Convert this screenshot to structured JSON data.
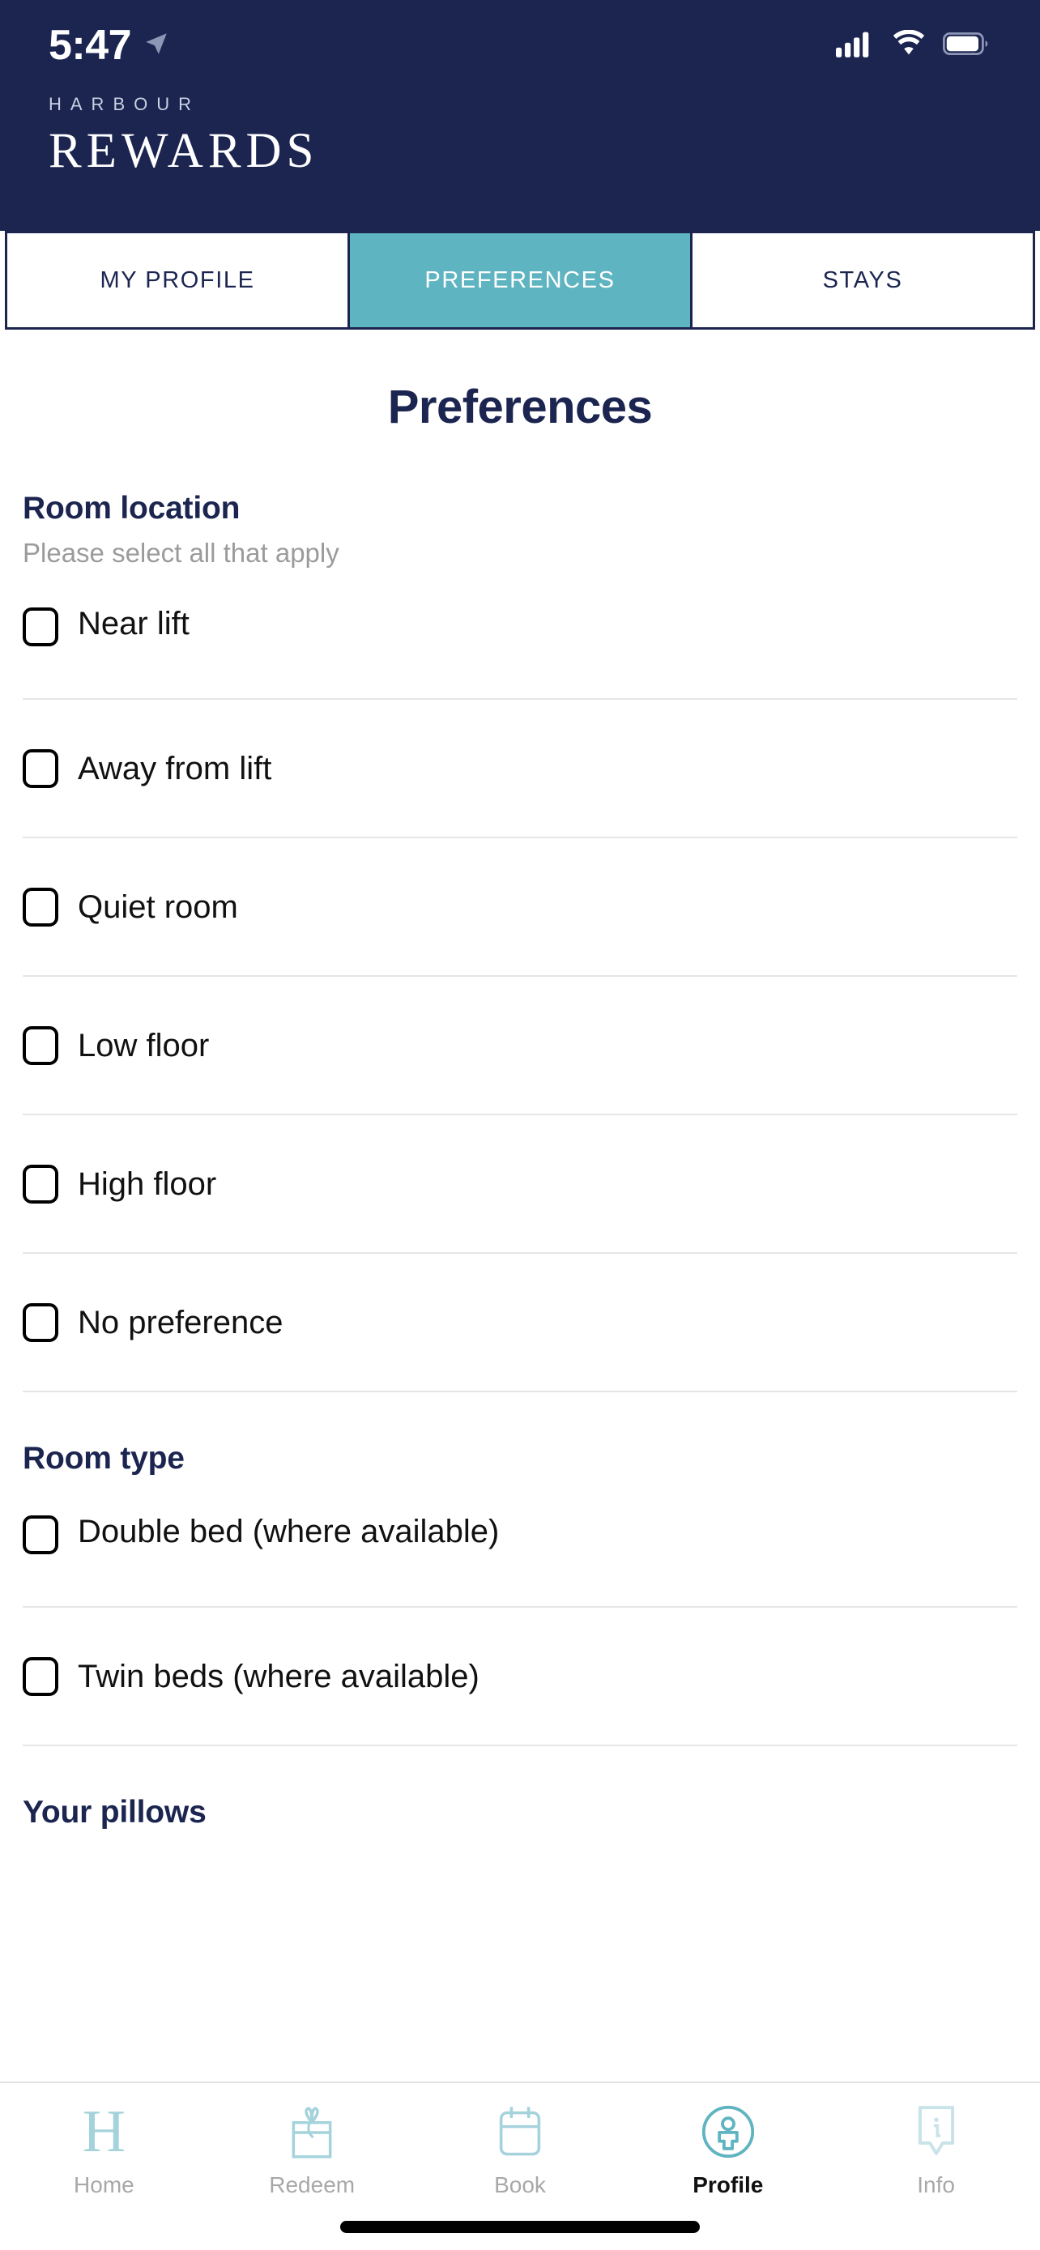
{
  "colors": {
    "navy": "#1b2550",
    "teal": "#5fb4c1",
    "teal_light": "#a5d3dc",
    "grey_text": "#9b9b9b",
    "divider": "#e6e6e6"
  },
  "status_bar": {
    "time": "5:47",
    "location_icon": "location-arrow-icon",
    "cellular_icon": "cellular-signal-icon",
    "wifi_icon": "wifi-icon",
    "battery_icon": "battery-icon"
  },
  "brand": {
    "line1": "HARBOUR",
    "line2": "REWARDS"
  },
  "tabs": [
    {
      "label": "MY PROFILE",
      "active": false
    },
    {
      "label": "PREFERENCES",
      "active": true
    },
    {
      "label": "STAYS",
      "active": false
    }
  ],
  "page": {
    "title": "Preferences"
  },
  "sections": [
    {
      "title": "Room location",
      "subtitle": "Please select all that apply",
      "options": [
        {
          "label": "Near lift",
          "checked": false
        },
        {
          "label": "Away from lift",
          "checked": false
        },
        {
          "label": "Quiet room",
          "checked": false
        },
        {
          "label": "Low floor",
          "checked": false
        },
        {
          "label": "High floor",
          "checked": false
        },
        {
          "label": "No preference",
          "checked": false
        }
      ]
    },
    {
      "title": "Room type",
      "subtitle": "",
      "options": [
        {
          "label": "Double bed (where available)",
          "checked": false
        },
        {
          "label": "Twin beds (where available)",
          "checked": false
        }
      ]
    },
    {
      "title": "Your pillows",
      "subtitle": "",
      "options": []
    }
  ],
  "bottom_nav": [
    {
      "label": "Home",
      "icon": "harbour-h-icon",
      "active": false
    },
    {
      "label": "Redeem",
      "icon": "gift-box-icon",
      "active": false
    },
    {
      "label": "Book",
      "icon": "calendar-icon",
      "active": false
    },
    {
      "label": "Profile",
      "icon": "person-circle-icon",
      "active": true
    },
    {
      "label": "Info",
      "icon": "info-bubble-icon",
      "active": false
    }
  ]
}
